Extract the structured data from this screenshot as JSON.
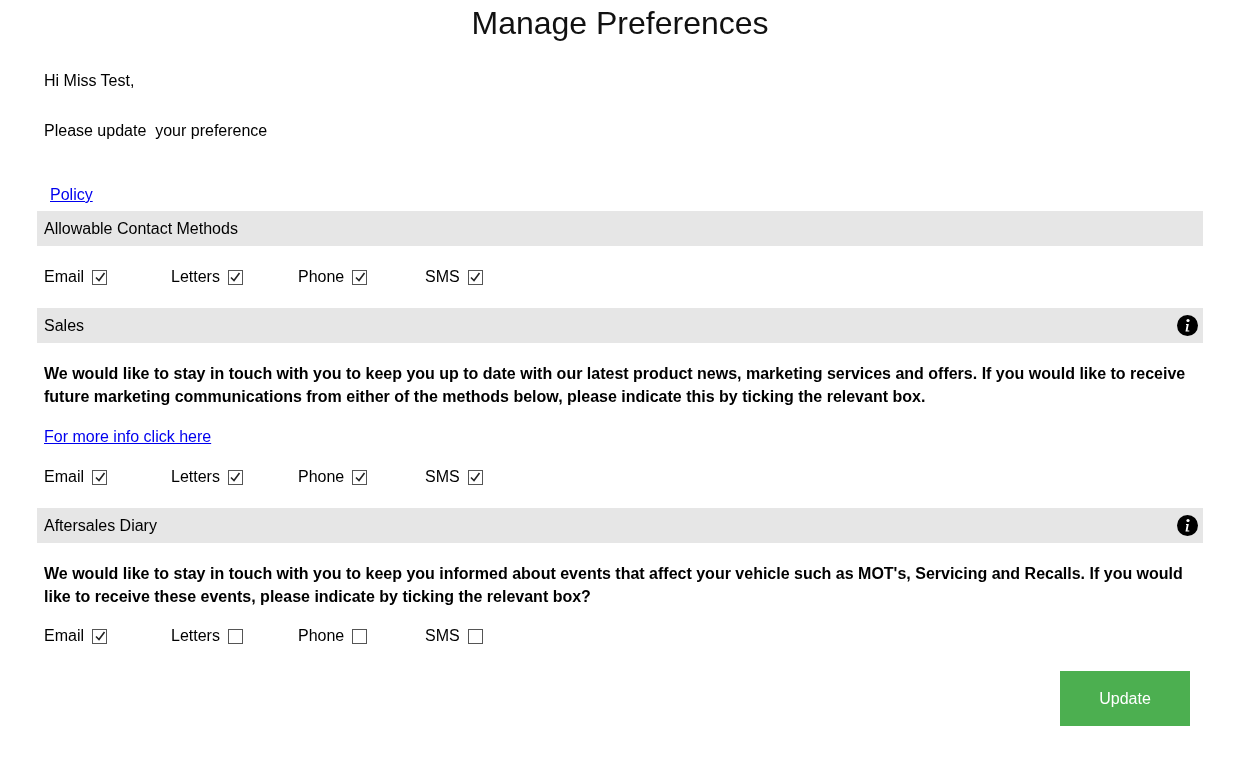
{
  "title": "Manage Preferences",
  "greeting": "Hi Miss Test,",
  "intro": "Please update  your preference",
  "policy_link": "Policy",
  "sections": [
    {
      "title": "Allowable Contact Methods",
      "info": false,
      "options": [
        {
          "label": "Email",
          "checked": true
        },
        {
          "label": "Letters",
          "checked": true
        },
        {
          "label": "Phone",
          "checked": true
        },
        {
          "label": "SMS",
          "checked": true
        }
      ]
    },
    {
      "title": "Sales",
      "info": true,
      "description": "We would like to stay in touch with you to keep you up to date with our latest product news, marketing services and offers. If you would like to receive future marketing communications from either of the methods below, please indicate this by ticking the relevant box.",
      "more_link": "For more info click here",
      "options": [
        {
          "label": "Email",
          "checked": true
        },
        {
          "label": "Letters",
          "checked": true
        },
        {
          "label": "Phone",
          "checked": true
        },
        {
          "label": "SMS",
          "checked": true
        }
      ]
    },
    {
      "title": "Aftersales Diary",
      "info": true,
      "description": "We would like to stay in touch with you to keep you informed about events that affect your vehicle such as MOT's, Servicing and Recalls. If you would like to receive these events, please indicate by ticking the relevant box?",
      "options": [
        {
          "label": "Email",
          "checked": true
        },
        {
          "label": "Letters",
          "checked": false
        },
        {
          "label": "Phone",
          "checked": false
        },
        {
          "label": "SMS",
          "checked": false
        }
      ]
    }
  ],
  "update_button": "Update"
}
